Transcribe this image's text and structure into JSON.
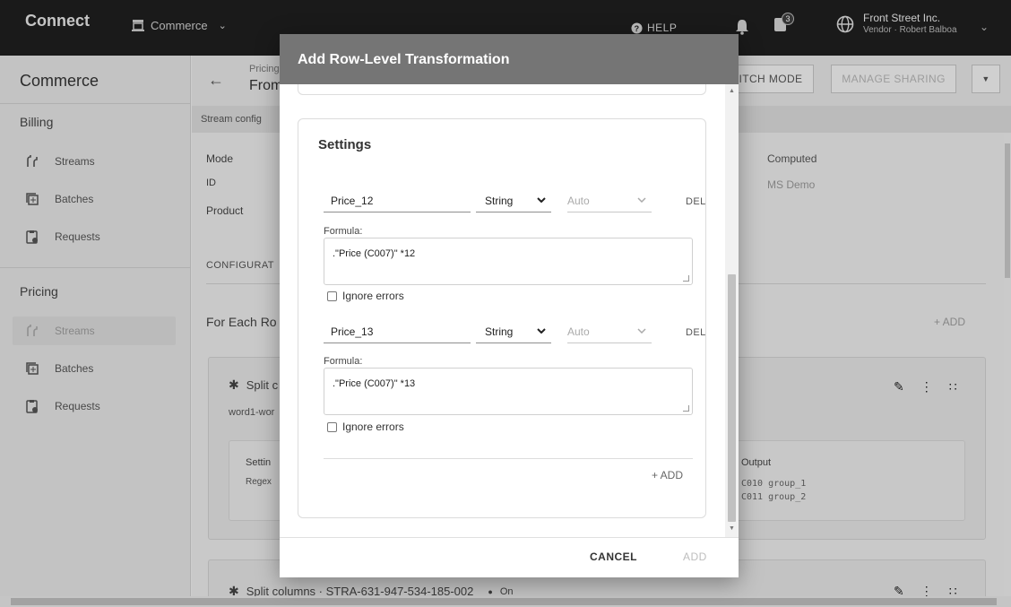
{
  "topbar": {
    "brand": "Connect",
    "module": "Commerce",
    "help": "HELP",
    "notif_count": "3",
    "account_name": "Front Street Inc.",
    "account_sub": "Vendor · Robert Balboa"
  },
  "sidebar": {
    "title": "Commerce",
    "billing_label": "Billing",
    "billing_items": [
      {
        "label": "Streams",
        "icon": "streams-icon"
      },
      {
        "label": "Batches",
        "icon": "batches-icon"
      },
      {
        "label": "Requests",
        "icon": "requests-icon"
      }
    ],
    "pricing_label": "Pricing",
    "pricing_items": [
      {
        "label": "Streams",
        "icon": "streams-icon",
        "active": true
      },
      {
        "label": "Batches",
        "icon": "batches-icon"
      },
      {
        "label": "Requests",
        "icon": "requests-icon"
      }
    ]
  },
  "main": {
    "crumb": "Pricing",
    "title": "From",
    "switch_mode": "ITCH MODE",
    "manage_sharing": "MANAGE SHARING",
    "strip": "Stream config",
    "mode_label": "Mode",
    "id_label": "ID",
    "product_label": "Product",
    "mode_value": "Computed",
    "product_value": "MS Demo",
    "config_label": "CONFIGURAT",
    "for_each": "For Each Ro",
    "add": "+ ADD",
    "card1": {
      "title": "Split c",
      "sub": "word1-wor",
      "settings": "Settin",
      "regex": "Regex",
      "output_label": "Output",
      "outputs": [
        "C010  group_1",
        "C011  group_2"
      ]
    },
    "card2": {
      "title": "Split columns · STRA-631-947-534-185-002",
      "status": "On"
    }
  },
  "dialog": {
    "title": "Add Row-Level Transformation",
    "settings_title": "Settings",
    "rows": [
      {
        "name": "Price_12",
        "type": "String",
        "auto": "Auto",
        "del": "DEL",
        "formula_label": "Formula:",
        "formula": ".\"Price (C007)\" *12",
        "ignore": "Ignore errors"
      },
      {
        "name": "Price_13",
        "type": "String",
        "auto": "Auto",
        "del": "DEL",
        "formula_label": "Formula:",
        "formula": ".\"Price (C007)\" *13",
        "ignore": "Ignore errors"
      }
    ],
    "add_row": "+ ADD",
    "cancel": "CANCEL",
    "add": "ADD"
  }
}
